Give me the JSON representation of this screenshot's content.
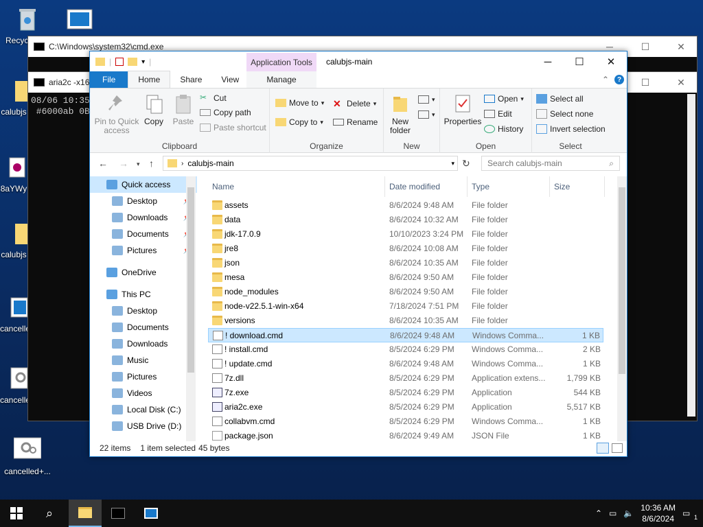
{
  "desktop": {
    "icons": [
      {
        "label": "Recycle Bin"
      },
      {
        "label": ""
      },
      {
        "label": "calubjs"
      },
      {
        "label": "8aYWy"
      },
      {
        "label": "calubjs"
      },
      {
        "label": "cancelled"
      },
      {
        "label": "cancelled"
      },
      {
        "label": "cancelled+..."
      }
    ]
  },
  "cmd_window": {
    "title": "C:\\Windows\\system32\\cmd.exe"
  },
  "aria_window": {
    "title": "aria2c -x16",
    "lines": [
      "08/06 10:35",
      " #6000ab 0B"
    ]
  },
  "explorer": {
    "title": "calubjs-main",
    "context_tab": "Application Tools",
    "tabs": {
      "file": "File",
      "home": "Home",
      "share": "Share",
      "view": "View",
      "manage": "Manage"
    },
    "ribbon": {
      "clipboard": {
        "group": "Clipboard",
        "pin": "Pin to Quick access",
        "copy": "Copy",
        "paste": "Paste",
        "cut": "Cut",
        "copy_path": "Copy path",
        "paste_shortcut": "Paste shortcut"
      },
      "organize": {
        "group": "Organize",
        "move_to": "Move to",
        "copy_to": "Copy to",
        "delete": "Delete",
        "rename": "Rename"
      },
      "new": {
        "group": "New",
        "new_folder": "New folder"
      },
      "open": {
        "group": "Open",
        "properties": "Properties",
        "open": "Open",
        "edit": "Edit",
        "history": "History"
      },
      "select": {
        "group": "Select",
        "select_all": "Select all",
        "select_none": "Select none",
        "invert": "Invert selection"
      }
    },
    "address": {
      "path": "calubjs-main",
      "search_placeholder": "Search calubjs-main"
    },
    "nav": [
      {
        "label": "Quick access",
        "level": 0,
        "pinned": false
      },
      {
        "label": "Desktop",
        "level": 1,
        "pinned": true
      },
      {
        "label": "Downloads",
        "level": 1,
        "pinned": true
      },
      {
        "label": "Documents",
        "level": 1,
        "pinned": true
      },
      {
        "label": "Pictures",
        "level": 1,
        "pinned": true
      },
      {
        "label": "OneDrive",
        "level": 0,
        "pinned": false
      },
      {
        "label": "This PC",
        "level": 0,
        "pinned": false
      },
      {
        "label": "Desktop",
        "level": 1,
        "pinned": false
      },
      {
        "label": "Documents",
        "level": 1,
        "pinned": false
      },
      {
        "label": "Downloads",
        "level": 1,
        "pinned": false
      },
      {
        "label": "Music",
        "level": 1,
        "pinned": false
      },
      {
        "label": "Pictures",
        "level": 1,
        "pinned": false
      },
      {
        "label": "Videos",
        "level": 1,
        "pinned": false
      },
      {
        "label": "Local Disk (C:)",
        "level": 1,
        "pinned": false
      },
      {
        "label": "USB Drive (D:)",
        "level": 1,
        "pinned": false
      }
    ],
    "columns": {
      "name": "Name",
      "date": "Date modified",
      "type": "Type",
      "size": "Size"
    },
    "files": [
      {
        "name": "assets",
        "date": "8/6/2024 9:48 AM",
        "type": "File folder",
        "size": "",
        "kind": "folder"
      },
      {
        "name": "data",
        "date": "8/6/2024 10:32 AM",
        "type": "File folder",
        "size": "",
        "kind": "folder"
      },
      {
        "name": "jdk-17.0.9",
        "date": "10/10/2023 3:24 PM",
        "type": "File folder",
        "size": "",
        "kind": "folder"
      },
      {
        "name": "jre8",
        "date": "8/6/2024 10:08 AM",
        "type": "File folder",
        "size": "",
        "kind": "folder"
      },
      {
        "name": "json",
        "date": "8/6/2024 10:35 AM",
        "type": "File folder",
        "size": "",
        "kind": "folder"
      },
      {
        "name": "mesa",
        "date": "8/6/2024 9:50 AM",
        "type": "File folder",
        "size": "",
        "kind": "folder"
      },
      {
        "name": "node_modules",
        "date": "8/6/2024 9:50 AM",
        "type": "File folder",
        "size": "",
        "kind": "folder"
      },
      {
        "name": "node-v22.5.1-win-x64",
        "date": "7/18/2024 7:51 PM",
        "type": "File folder",
        "size": "",
        "kind": "folder"
      },
      {
        "name": "versions",
        "date": "8/6/2024 10:35 AM",
        "type": "File folder",
        "size": "",
        "kind": "folder"
      },
      {
        "name": "! download.cmd",
        "date": "8/6/2024 9:48 AM",
        "type": "Windows Comma...",
        "size": "1 KB",
        "kind": "cmd",
        "selected": true
      },
      {
        "name": "! install.cmd",
        "date": "8/5/2024 6:29 PM",
        "type": "Windows Comma...",
        "size": "2 KB",
        "kind": "cmd"
      },
      {
        "name": "! update.cmd",
        "date": "8/6/2024 9:48 AM",
        "type": "Windows Comma...",
        "size": "1 KB",
        "kind": "cmd"
      },
      {
        "name": "7z.dll",
        "date": "8/5/2024 6:29 PM",
        "type": "Application extens...",
        "size": "1,799 KB",
        "kind": "cmd"
      },
      {
        "name": "7z.exe",
        "date": "8/5/2024 6:29 PM",
        "type": "Application",
        "size": "544 KB",
        "kind": "exe"
      },
      {
        "name": "aria2c.exe",
        "date": "8/5/2024 6:29 PM",
        "type": "Application",
        "size": "5,517 KB",
        "kind": "exe"
      },
      {
        "name": "collabvm.cmd",
        "date": "8/5/2024 6:29 PM",
        "type": "Windows Comma...",
        "size": "1 KB",
        "kind": "cmd"
      },
      {
        "name": "package.json",
        "date": "8/6/2024 9:49 AM",
        "type": "JSON File",
        "size": "1 KB",
        "kind": "doc"
      }
    ],
    "status": {
      "count": "22 items",
      "selected": "1 item selected",
      "size": "45 bytes"
    }
  },
  "taskbar": {
    "time": "10:36 AM",
    "date": "8/6/2024",
    "notification_count": "1"
  },
  "colors": {
    "accent": "#1979ca",
    "selection": "#cce8ff",
    "context_tab": "#f0d9f7",
    "taskbar": "#101010"
  }
}
